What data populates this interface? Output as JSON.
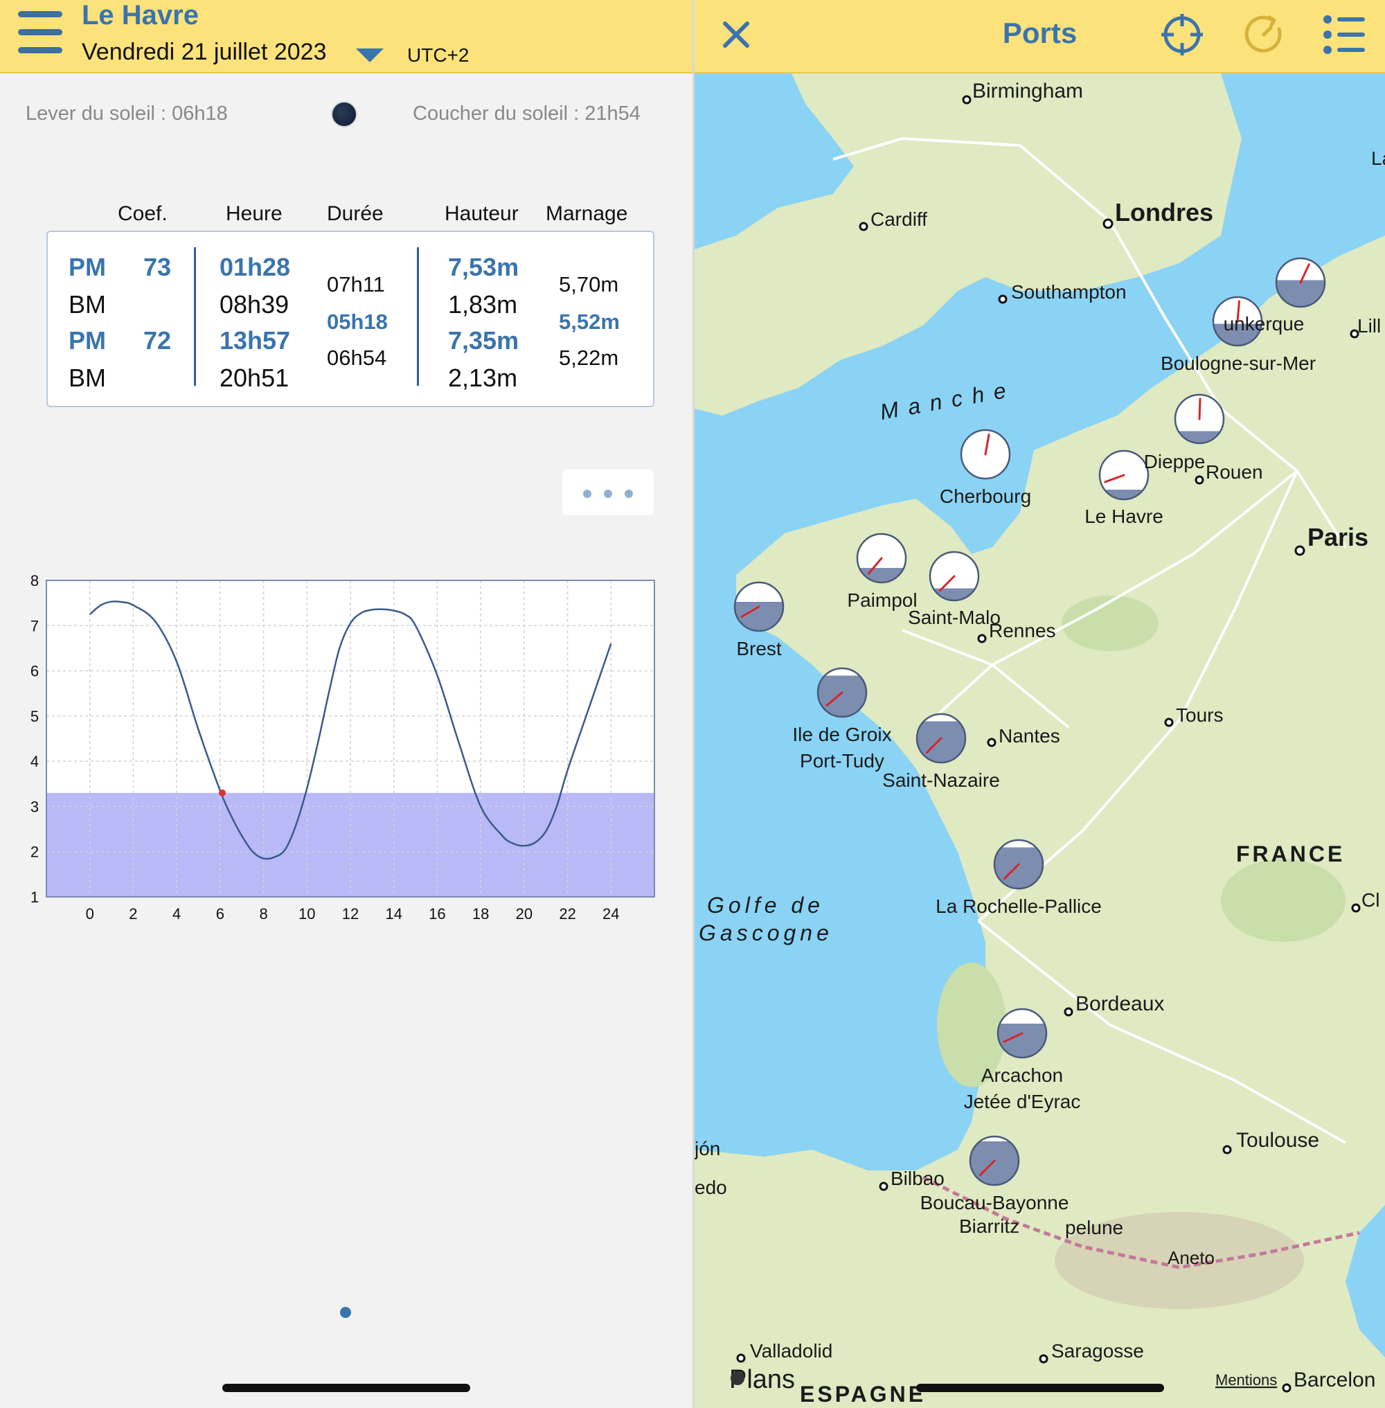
{
  "header": {
    "port_name": "Le Havre",
    "date": "Vendredi 21 juillet 2023",
    "timezone": "UTC+2"
  },
  "sun": {
    "sunrise": "Lever du soleil : 06h18",
    "sunset": "Coucher du soleil : 21h54"
  },
  "tide_table": {
    "columns": [
      "Coef.",
      "Heure",
      "Durée",
      "Hauteur",
      "Marnage"
    ],
    "rows": [
      {
        "type": "PM",
        "coef": "73",
        "time": "01h28",
        "height": "7,53m"
      },
      {
        "type": "BM",
        "coef": "",
        "time": "08h39",
        "height": "1,83m"
      },
      {
        "type": "PM",
        "coef": "72",
        "time": "13h57",
        "height": "7,35m"
      },
      {
        "type": "BM",
        "coef": "",
        "time": "20h51",
        "height": "2,13m"
      }
    ],
    "durations": [
      "07h11",
      "05h18",
      "06h54"
    ],
    "ranges": [
      "5,70m",
      "5,52m",
      "5,22m"
    ]
  },
  "chart_data": {
    "type": "line",
    "title": "",
    "xlabel": "",
    "ylabel": "",
    "xlim": [
      -2,
      26
    ],
    "ylim": [
      1,
      8
    ],
    "x_ticks": [
      0,
      2,
      4,
      6,
      8,
      10,
      12,
      14,
      16,
      18,
      20,
      22,
      24
    ],
    "y_ticks": [
      1,
      2,
      3,
      4,
      5,
      6,
      7,
      8
    ],
    "grid": true,
    "threshold_fill": {
      "from": 1,
      "to": 3.3,
      "color": "#b9b9f7"
    },
    "current_point": {
      "x": 6.1,
      "y": 3.3
    },
    "series": [
      {
        "x": [
          0,
          0.5,
          1,
          1.5,
          2,
          3,
          4,
          5,
          6,
          6.5,
          7,
          7.5,
          8,
          8.5,
          9,
          9.5,
          10,
          10.5,
          11,
          11.5,
          12,
          12.5,
          13,
          13.5,
          14,
          14.5,
          15,
          16,
          17,
          18,
          19,
          19.5,
          20,
          20.5,
          21,
          21.5,
          22,
          23,
          24
        ],
        "y": [
          7.25,
          7.45,
          7.53,
          7.52,
          7.45,
          7.1,
          6.2,
          4.7,
          3.35,
          2.8,
          2.35,
          2.0,
          1.85,
          1.88,
          2.05,
          2.6,
          3.4,
          4.4,
          5.5,
          6.5,
          7.05,
          7.28,
          7.35,
          7.36,
          7.33,
          7.25,
          7.0,
          5.9,
          4.4,
          3.0,
          2.35,
          2.18,
          2.13,
          2.2,
          2.45,
          3.0,
          3.8,
          5.2,
          6.6
        ],
        "color": "#3a5a8c"
      }
    ]
  },
  "map": {
    "title": "Ports",
    "cities": [
      "Birmingham",
      "Londres",
      "Cardiff",
      "Southampton",
      "Lill",
      "Rouen",
      "Paris",
      "Rennes",
      "Nantes",
      "Tours",
      "Bordeaux",
      "Toulouse",
      "Bilbao",
      "Biarritz",
      "Aneto",
      "Valladolid",
      "Saragosse",
      "Barcelon",
      "Cl",
      "La",
      "jón",
      "edo"
    ],
    "seas": [
      "Manche",
      "Golfe de",
      "Gascogne"
    ],
    "countries": [
      "FRANCE",
      "ESPAGNE"
    ],
    "ports": [
      "unkerque",
      "Boulogne-sur-Mer",
      "Dieppe",
      "Le Havre",
      "Cherbourg",
      "Paimpol",
      "Saint-Malo",
      "Brest",
      "Ile de Groix",
      "Port-Tudy",
      "Saint-Nazaire",
      "La Rochelle-Pallice",
      "Arcachon",
      "Jetée d'Eyrac",
      "Boucau-Bayonne",
      "pelune"
    ],
    "attribution": "Plans",
    "legal": "Mentions",
    "colors": {
      "sea": "#8ad3f4",
      "land": "#dfe9c2",
      "forest": "#c9deaa",
      "road": "#ffffff",
      "accent": "#3a74ad",
      "header": "#fbe27b"
    }
  }
}
